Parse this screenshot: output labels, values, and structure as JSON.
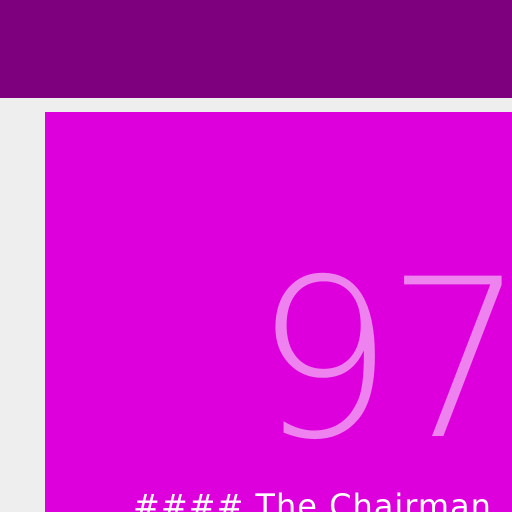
{
  "app_bar": {
    "color": "#7f007f"
  },
  "card": {
    "background": "#dd00dd",
    "number": "97",
    "number_color": "#ee82ee",
    "caption": "#### The Chairman"
  },
  "page": {
    "background": "#eeeeee"
  }
}
